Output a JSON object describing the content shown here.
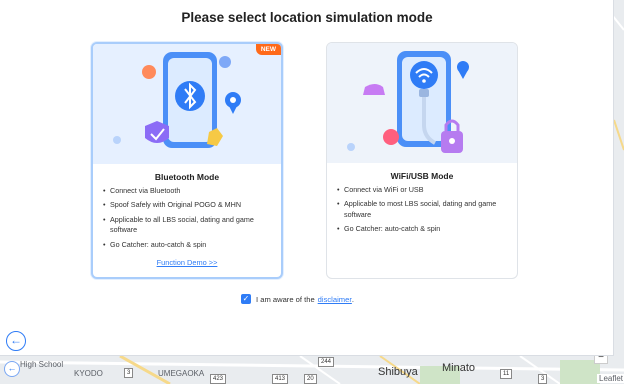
{
  "dialog": {
    "title": "Please select location simulation mode"
  },
  "bluetooth_card": {
    "badge": "NEW",
    "title": "Bluetooth Mode",
    "features": [
      "Connect via Bluetooth",
      "Spoof Safely with Original POGO & MHN",
      "Applicable to all LBS social, dating and game software",
      "Go Catcher: auto-catch & spin"
    ],
    "demo_link": "Function Demo >>"
  },
  "wifi_card": {
    "title": "WiFi/USB Mode",
    "features": [
      "Connect via WiFi or USB",
      "Applicable to most LBS social, dating and game software",
      "Go Catcher: auto-catch & spin"
    ]
  },
  "agreement": {
    "text": "I am aware of the",
    "link": "disclaimer",
    "suffix": ".",
    "checked": true
  },
  "map": {
    "labels": [
      "High School",
      "KYODO",
      "UMEGAOKA",
      "Minato",
      "Shibuya"
    ],
    "shields": [
      "244",
      "3",
      "423",
      "413",
      "20",
      "11",
      "3"
    ],
    "attribution": "Leaflet"
  },
  "colors": {
    "accent": "#2f7cf6",
    "badge": "#ff6a1a",
    "selected_border": "#a9cdfb"
  }
}
